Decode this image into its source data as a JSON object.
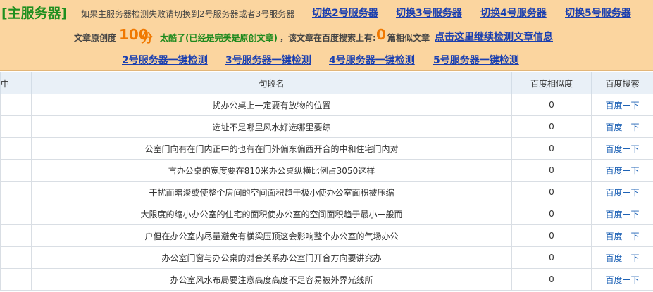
{
  "header": {
    "main_server": "[主服务器]",
    "notice": "如果主服务器检测失败请切换到2号服务器或者3号服务器",
    "switch_links": [
      "切换2号服务器",
      "切换3号服务器",
      "切换4号服务器",
      "切换5号服务器"
    ]
  },
  "originality": {
    "label": "文章原创度",
    "score": "100",
    "unit": "分",
    "verdict": "太酷了(已经是完美是原创文章)",
    "similar_prefix": "，该文章在百度搜索上有:",
    "similar_count": "0",
    "similar_suffix": "篇相似文章",
    "continue_link": "点击这里继续检测文章信息"
  },
  "one_click_checks": [
    "2号服务器一键检测",
    "3号服务器一键检测",
    "4号服务器一键检测",
    "5号服务器一键检测"
  ],
  "table": {
    "headers": [
      "中",
      "句段名",
      "百度相似度",
      "百度搜索"
    ],
    "rows": [
      {
        "mark": "",
        "sentence": "扰办公桌上一定要有放物的位置",
        "similarity": "0",
        "search": "百度一下"
      },
      {
        "mark": "",
        "sentence": "选址不是哪里风水好选哪里要综",
        "similarity": "0",
        "search": "百度一下"
      },
      {
        "mark": "",
        "sentence": "公室门向有在门内正中的也有在门外偏东偏西开合的中和住宅门内对",
        "similarity": "0",
        "search": "百度一下"
      },
      {
        "mark": "",
        "sentence": "言办公桌的宽度要在810米办公桌纵横比例占3050这样",
        "similarity": "0",
        "search": "百度一下"
      },
      {
        "mark": "",
        "sentence": "干扰而暗淡或使整个房间的空间面积趋于极小使办公室面积被压缩",
        "similarity": "0",
        "search": "百度一下"
      },
      {
        "mark": "",
        "sentence": "大限度的缩小办公室的住宅的面积使办公室的空间面积趋于最小一般而",
        "similarity": "0",
        "search": "百度一下"
      },
      {
        "mark": "",
        "sentence": "户但在办公室内尽量避免有横梁压顶这会影响整个办公室的气场办公",
        "similarity": "0",
        "search": "百度一下"
      },
      {
        "mark": "",
        "sentence": "办公室门窗与办公桌的对合关系办公室门开合方向要讲究办",
        "similarity": "0",
        "search": "百度一下"
      },
      {
        "mark": "",
        "sentence": "办公室风水布局要注意高度高度不足容易被外界光线所",
        "similarity": "0",
        "search": "百度一下"
      }
    ]
  }
}
